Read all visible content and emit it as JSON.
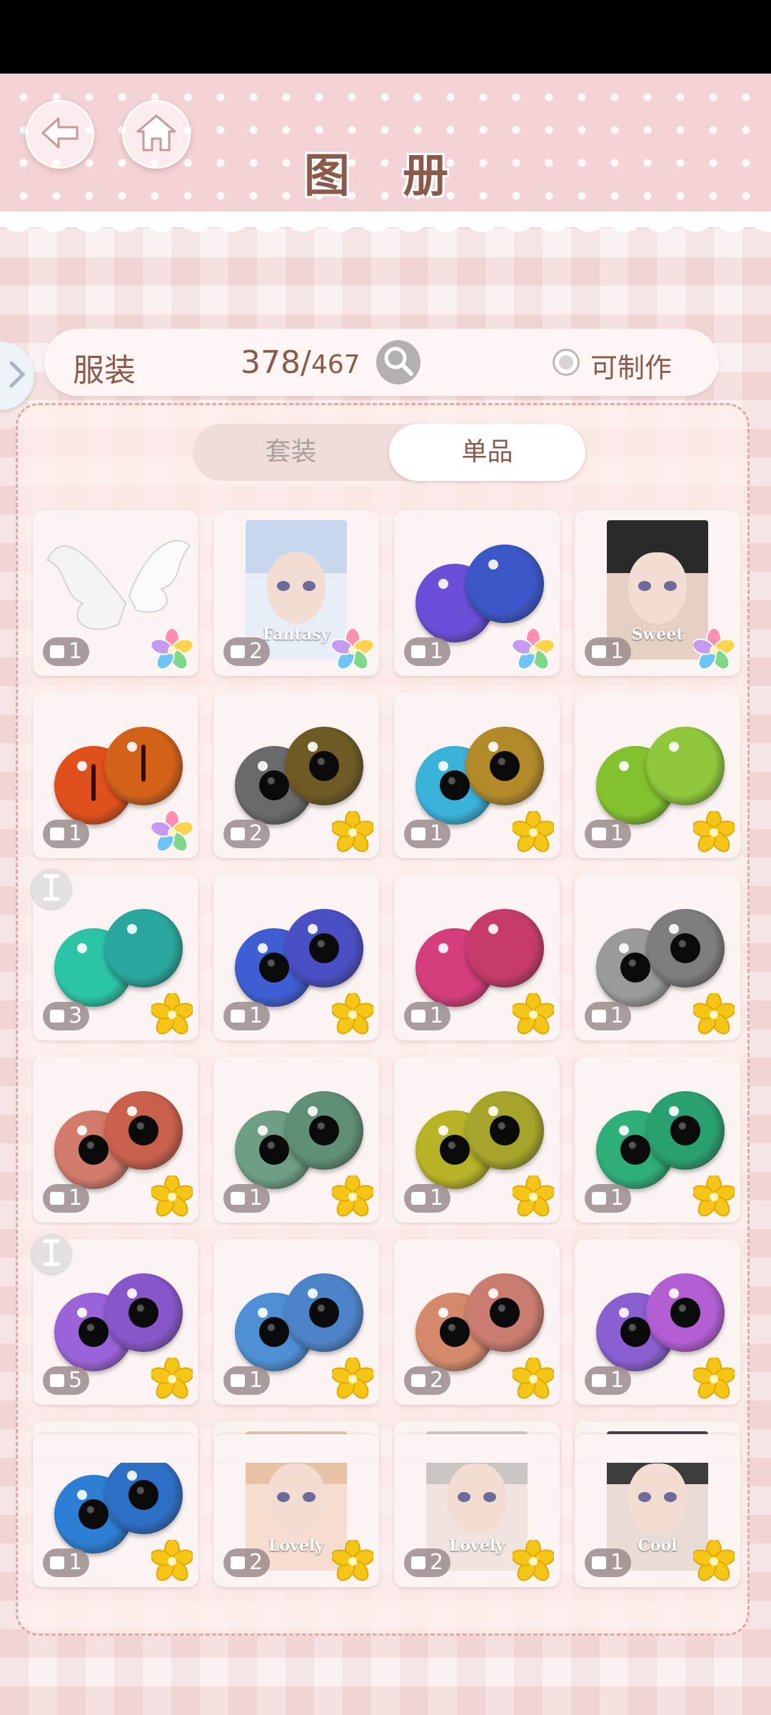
{
  "header": {
    "title": "图 册"
  },
  "filter": {
    "category": "服装",
    "owned": "378/",
    "total": "467",
    "craftable_label": "可制作"
  },
  "segment": {
    "tabs": [
      {
        "label": "套装"
      },
      {
        "label": "单品"
      }
    ],
    "active": 1
  },
  "items": [
    {
      "type": "wings",
      "count": "1",
      "star": "rainbow"
    },
    {
      "type": "portrait",
      "label": "Fantasy",
      "count": "2",
      "star": "rainbow",
      "palette": [
        "#c6d7ee",
        "#e8eef8"
      ]
    },
    {
      "type": "eyes",
      "count": "1",
      "star": "rainbow",
      "colors": [
        "#6b4fd8",
        "#3b58c6"
      ],
      "pupil": "galaxy"
    },
    {
      "type": "portrait",
      "label": "Sweet",
      "count": "1",
      "star": "rainbow",
      "palette": [
        "#2a2a2a",
        "#e7cfc4"
      ]
    },
    {
      "type": "eyes",
      "count": "1",
      "star": "rainbow",
      "colors": [
        "#e0501c",
        "#d36218"
      ],
      "pupil": "slit"
    },
    {
      "type": "eyes",
      "count": "2",
      "star": "gold",
      "colors": [
        "#6a6a6a",
        "#6e5a24"
      ]
    },
    {
      "type": "eyes",
      "count": "1",
      "star": "gold",
      "colors": [
        "#3ab2d9",
        "#b38a2a"
      ]
    },
    {
      "type": "eyes",
      "count": "1",
      "star": "gold",
      "colors": [
        "#83c12e",
        "#8fc83c"
      ],
      "pupil": "none"
    },
    {
      "type": "eyes",
      "count": "3",
      "star": "gold",
      "colors": [
        "#2cc4a6",
        "#2aa79d"
      ],
      "pupil": "none"
    },
    {
      "type": "eyes",
      "count": "1",
      "star": "gold",
      "colors": [
        "#3f5ed3",
        "#4a4fc4"
      ]
    },
    {
      "type": "eyes",
      "count": "1",
      "star": "gold",
      "colors": [
        "#d43e7c",
        "#c73b6a"
      ],
      "pupil": "none"
    },
    {
      "type": "eyes",
      "count": "1",
      "star": "gold",
      "colors": [
        "#9a9a9a",
        "#7d7d7d"
      ]
    },
    {
      "type": "eyes",
      "count": "1",
      "star": "gold",
      "colors": [
        "#d27b6a",
        "#c9604b"
      ]
    },
    {
      "type": "eyes",
      "count": "1",
      "star": "gold",
      "colors": [
        "#6e9f84",
        "#5f8f74"
      ]
    },
    {
      "type": "eyes",
      "count": "1",
      "star": "gold",
      "colors": [
        "#b7b226",
        "#a6a42a"
      ]
    },
    {
      "type": "eyes",
      "count": "1",
      "star": "gold",
      "colors": [
        "#2fae78",
        "#2a9f6f"
      ]
    },
    {
      "type": "eyes",
      "count": "5",
      "star": "gold",
      "colors": [
        "#9b63d8",
        "#8757c9"
      ]
    },
    {
      "type": "eyes",
      "count": "1",
      "star": "gold",
      "colors": [
        "#4f8fd5",
        "#4d84c9"
      ]
    },
    {
      "type": "eyes",
      "count": "2",
      "star": "gold",
      "colors": [
        "#d48a6a",
        "#c97c6f"
      ]
    },
    {
      "type": "eyes",
      "count": "1",
      "star": "gold",
      "colors": [
        "#8a5fcf",
        "#b45ed4"
      ]
    },
    {
      "type": "eyes",
      "count": "1",
      "star": "gold",
      "colors": [
        "#2c7fd4",
        "#2d6fc5"
      ]
    },
    {
      "type": "portrait",
      "label": "Lovely",
      "count": "2",
      "star": "gold",
      "palette": [
        "#e7c2a6",
        "#f6ddd0"
      ]
    },
    {
      "type": "portrait",
      "label": "Lovely",
      "count": "2",
      "star": "gold",
      "palette": [
        "#c9c6c4",
        "#f1e4e0"
      ]
    },
    {
      "type": "portrait",
      "label": "Cool",
      "count": "1",
      "star": "gold",
      "palette": [
        "#3c3c3c",
        "#e9dcd6"
      ]
    }
  ],
  "icons": {
    "back": "back-arrow-icon",
    "home": "home-icon",
    "search": "search-icon",
    "side": "chevron-right-icon",
    "tip": "info-i-icon"
  },
  "colors": {
    "accent": "#8a5a4a",
    "header_pink": "#f3d3d6",
    "badge_bg": "#9b8c8c",
    "gold": "#f5c518"
  }
}
